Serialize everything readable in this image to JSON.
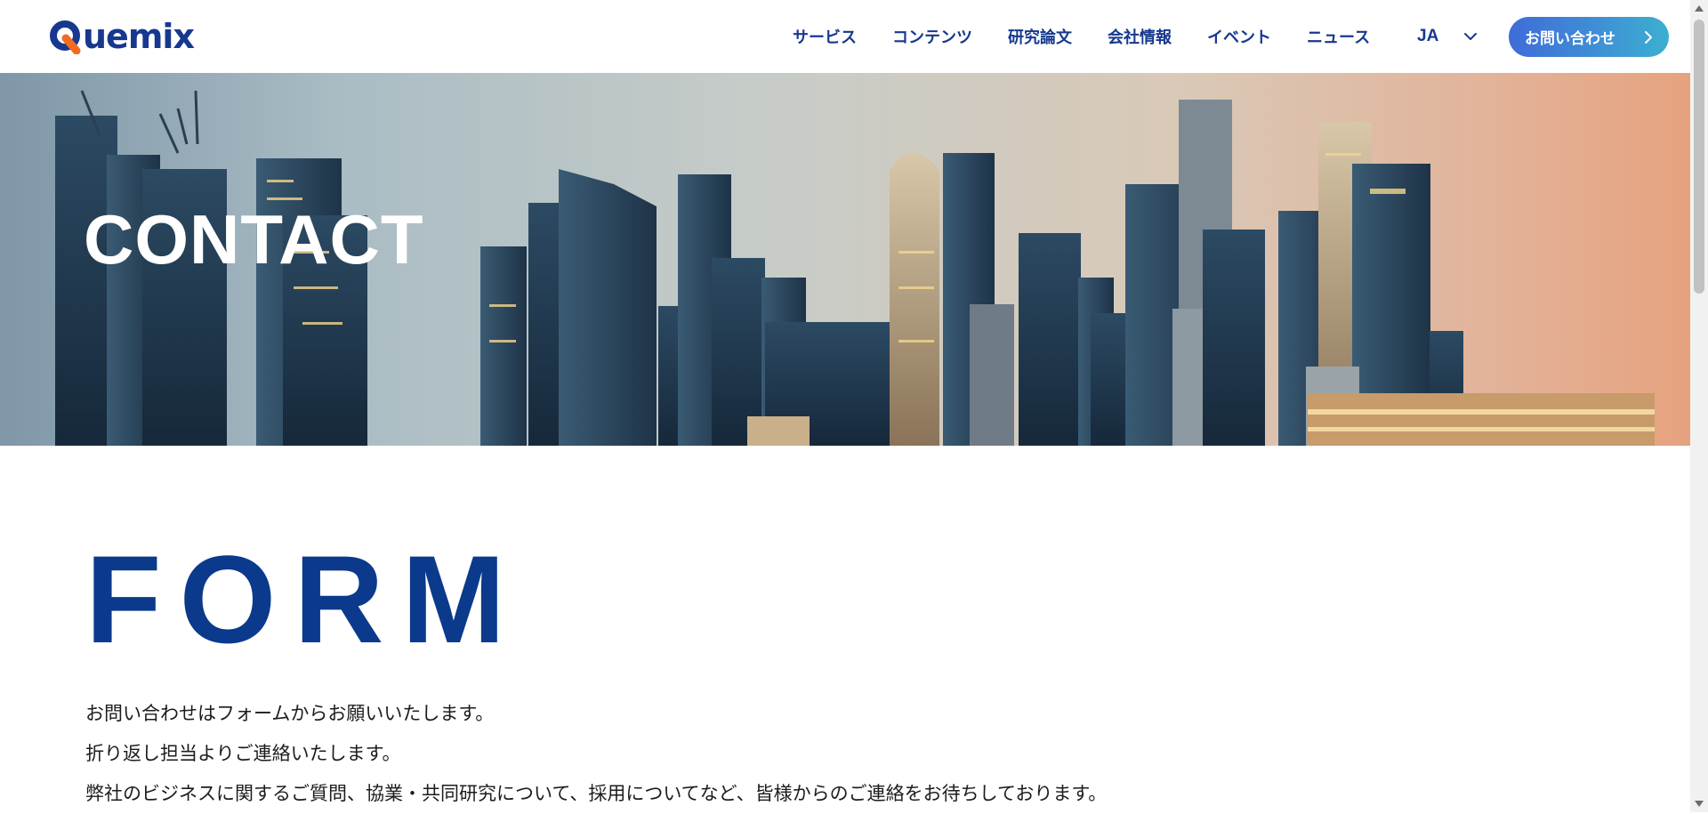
{
  "header": {
    "logo_text": "uemix",
    "logo_q_label": "Q",
    "nav": [
      {
        "label": "サービス"
      },
      {
        "label": "コンテンツ"
      },
      {
        "label": "研究論文"
      },
      {
        "label": "会社情報"
      },
      {
        "label": "イベント"
      },
      {
        "label": "ニュース"
      }
    ],
    "language": "JA",
    "cta_label": "お問い合わせ"
  },
  "hero": {
    "title": "CONTACT"
  },
  "form_section": {
    "title": "FORM",
    "intro": [
      "お問い合わせはフォームからお願いいたします。",
      "折り返し担当よりご連絡いたします。",
      "弊社のビジネスに関するご質問、協業・共同研究について、採用についてなど、皆様からのご連絡をお待ちしております。"
    ]
  },
  "colors": {
    "brand_navy": "#16388f",
    "form_title": "#0b3a8c",
    "logo_orange": "#f26b21",
    "cta_gradient_start": "#3f6cd8",
    "cta_gradient_end": "#3bb0d0"
  },
  "icons": {
    "language_dropdown": "chevron-down-icon",
    "cta_arrow": "chevron-right-icon"
  }
}
